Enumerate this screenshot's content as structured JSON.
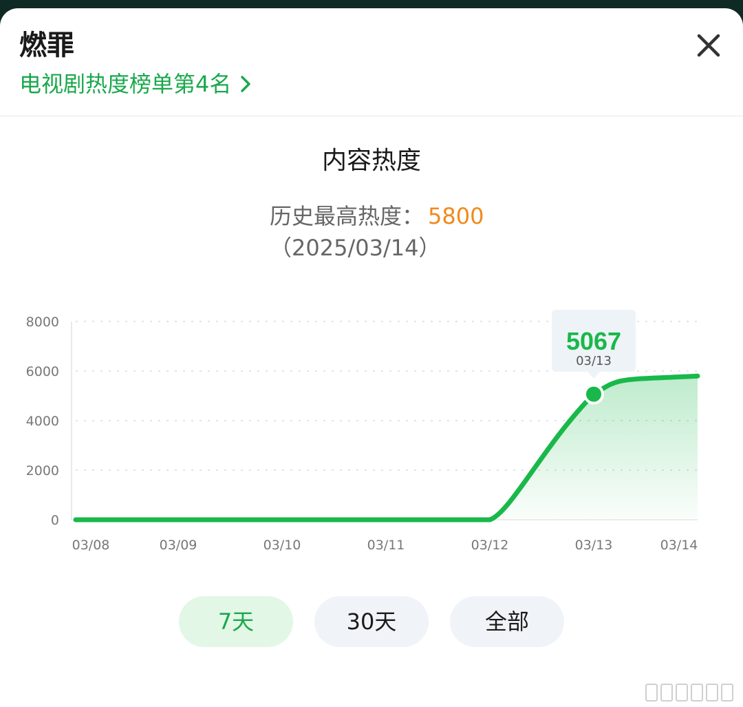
{
  "header": {
    "title": "燃罪",
    "rank_text": "电视剧热度榜单第4名"
  },
  "summary": {
    "section_title": "内容热度",
    "peak_label": "历史最高热度：",
    "peak_value": "5800",
    "peak_date": "（2025/03/14）"
  },
  "tooltip": {
    "value": "5067",
    "date": "03/13"
  },
  "filters": {
    "items": [
      "7天",
      "30天",
      "全部"
    ],
    "selected": "7天"
  },
  "colors": {
    "accent_green": "#19b84a",
    "peak_orange": "#f08a1a",
    "active_filter_bg": "#e2f7e6",
    "filter_bg": "#f0f3f7"
  },
  "chart_data": {
    "type": "area",
    "title": "",
    "xlabel": "",
    "ylabel": "",
    "categories": [
      "03/08",
      "03/09",
      "03/10",
      "03/11",
      "03/12",
      "03/13",
      "03/14"
    ],
    "series": [
      {
        "values": [
          0,
          0,
          0,
          0,
          0,
          5067,
          5800
        ]
      }
    ],
    "ylim": [
      0,
      8000
    ],
    "yticks": [
      0,
      2000,
      4000,
      6000,
      8000
    ],
    "grid": true,
    "highlight": {
      "category": "03/13",
      "value": 5067
    }
  }
}
